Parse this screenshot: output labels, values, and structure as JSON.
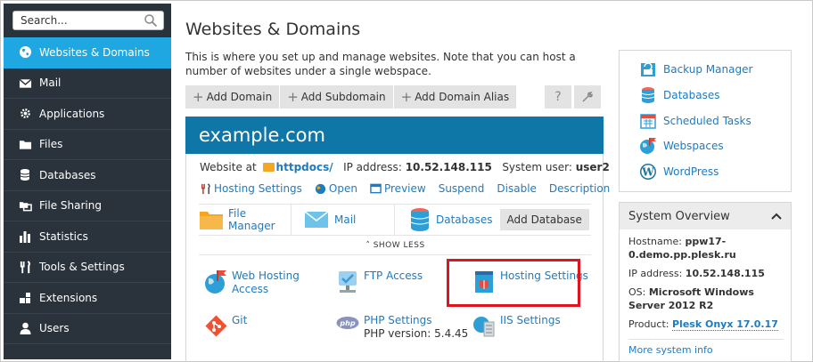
{
  "search": {
    "placeholder": "Search..."
  },
  "sidebar": {
    "items": [
      {
        "label": "Websites & Domains",
        "icon": "globe-icon",
        "active": true
      },
      {
        "label": "Mail",
        "icon": "envelope-icon"
      },
      {
        "label": "Applications",
        "icon": "gear-icon"
      },
      {
        "label": "Files",
        "icon": "folder-icon"
      },
      {
        "label": "Databases",
        "icon": "database-icon"
      },
      {
        "label": "File Sharing",
        "icon": "file-sharing-icon"
      },
      {
        "label": "Statistics",
        "icon": "bar-chart-icon"
      },
      {
        "label": "Tools & Settings",
        "icon": "tools-icon"
      },
      {
        "label": "Extensions",
        "icon": "puzzle-icon"
      },
      {
        "label": "Users",
        "icon": "user-icon"
      }
    ]
  },
  "main": {
    "title": "Websites & Domains",
    "description": "This is where you set up and manage websites. Note that you can host a number of websites under a single webspace.",
    "toolbar": {
      "add_domain": "Add Domain",
      "add_subdomain": "Add Subdomain",
      "add_domain_alias": "Add Domain Alias",
      "help": "?"
    },
    "domain": {
      "name": "example.com",
      "website_at_label": "Website at",
      "doc_root": "httpdocs/",
      "ip_label": "IP address:",
      "ip": "10.52.148.115",
      "user_label": "System user:",
      "user": "user2",
      "actions": {
        "hosting_settings": "Hosting Settings",
        "open": "Open",
        "preview": "Preview",
        "suspend": "Suspend",
        "disable": "Disable",
        "description": "Description"
      },
      "quick": {
        "file_manager_1": "File",
        "file_manager_2": "Manager",
        "mail": "Mail",
        "databases": "Databases",
        "add_database": "Add Database"
      },
      "show_less": "SHOW LESS",
      "tools": {
        "web_hosting_access_1": "Web Hosting",
        "web_hosting_access_2": "Access",
        "ftp_access": "FTP Access",
        "hosting_settings": "Hosting Settings",
        "git": "Git",
        "php_settings": "PHP Settings",
        "php_version": "PHP version: 5.4.45",
        "iis_settings": "IIS Settings"
      }
    }
  },
  "right": {
    "links": {
      "backup_manager": "Backup Manager",
      "databases": "Databases",
      "scheduled_tasks": "Scheduled Tasks",
      "webspaces": "Webspaces",
      "wordpress": "WordPress"
    },
    "overview": {
      "title": "System Overview",
      "hostname_label": "Hostname:",
      "hostname": "ppw17-0.demo.pp.plesk.ru",
      "ip_label": "IP address:",
      "ip": "10.52.148.115",
      "os_label": "OS:",
      "os": "Microsoft Windows Server 2012 R2",
      "product_label": "Product:",
      "product": "Plesk Onyx 17.0.17",
      "more": "More system info"
    }
  },
  "colors": {
    "sidebar_bg": "#2a323b",
    "active_item": "#1ea7e0",
    "domain_header": "#0f76a8",
    "link": "#1f7bbf",
    "highlight_border": "#e0141e"
  }
}
